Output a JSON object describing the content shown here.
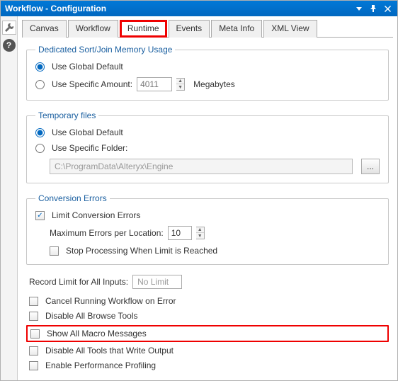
{
  "window": {
    "title": "Workflow - Configuration"
  },
  "tabs": {
    "canvas": "Canvas",
    "workflow": "Workflow",
    "runtime": "Runtime",
    "events": "Events",
    "metainfo": "Meta Info",
    "xmlview": "XML View"
  },
  "memory": {
    "legend": "Dedicated Sort/Join Memory Usage",
    "useGlobal": "Use Global Default",
    "useSpecific": "Use Specific Amount:",
    "amount": "4011",
    "unit": "Megabytes"
  },
  "tempfiles": {
    "legend": "Temporary files",
    "useGlobal": "Use Global Default",
    "useFolder": "Use Specific Folder:",
    "path": "C:\\ProgramData\\Alteryx\\Engine",
    "browse": "..."
  },
  "convErrors": {
    "legend": "Conversion Errors",
    "limit": "Limit Conversion Errors",
    "maxPerLoc": "Maximum Errors per Location:",
    "maxVal": "10",
    "stop": "Stop Processing When Limit is Reached"
  },
  "options": {
    "recordLimitLabel": "Record Limit for All Inputs:",
    "recordLimitValue": "No Limit",
    "cancelOnError": "Cancel Running Workflow on Error",
    "disableBrowse": "Disable All Browse Tools",
    "showMacro": "Show All Macro Messages",
    "disableWrite": "Disable All Tools that Write Output",
    "perfProfile": "Enable Performance Profiling"
  }
}
